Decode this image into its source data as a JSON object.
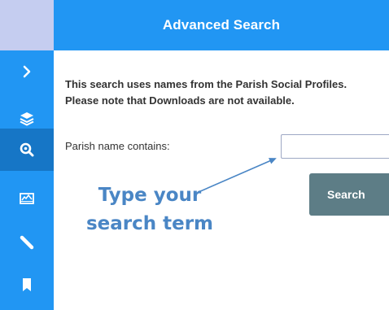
{
  "header": {
    "title": "Advanced Search"
  },
  "rail": {
    "items": [
      {
        "icon": "chevron-right-icon",
        "active": false
      },
      {
        "icon": "layers-icon",
        "active": false
      },
      {
        "icon": "search-zoom-icon",
        "active": true
      },
      {
        "icon": "map-icon",
        "active": false
      },
      {
        "icon": "ruler-icon",
        "active": false
      },
      {
        "icon": "bookmark-icon",
        "active": false
      }
    ],
    "accent": "#2196f3",
    "active_color": "#1676c6"
  },
  "main": {
    "info_line1": "This search uses names from the Parish Social Profiles.",
    "info_line2": "Please note that Downloads are not available.",
    "parish_label": "Parish name contains:",
    "parish_value": "",
    "search_label": "Search",
    "search_color": "#5d7d86"
  },
  "annotation": {
    "line1": "Type your",
    "line2": "search term",
    "color": "#4a86c5"
  }
}
